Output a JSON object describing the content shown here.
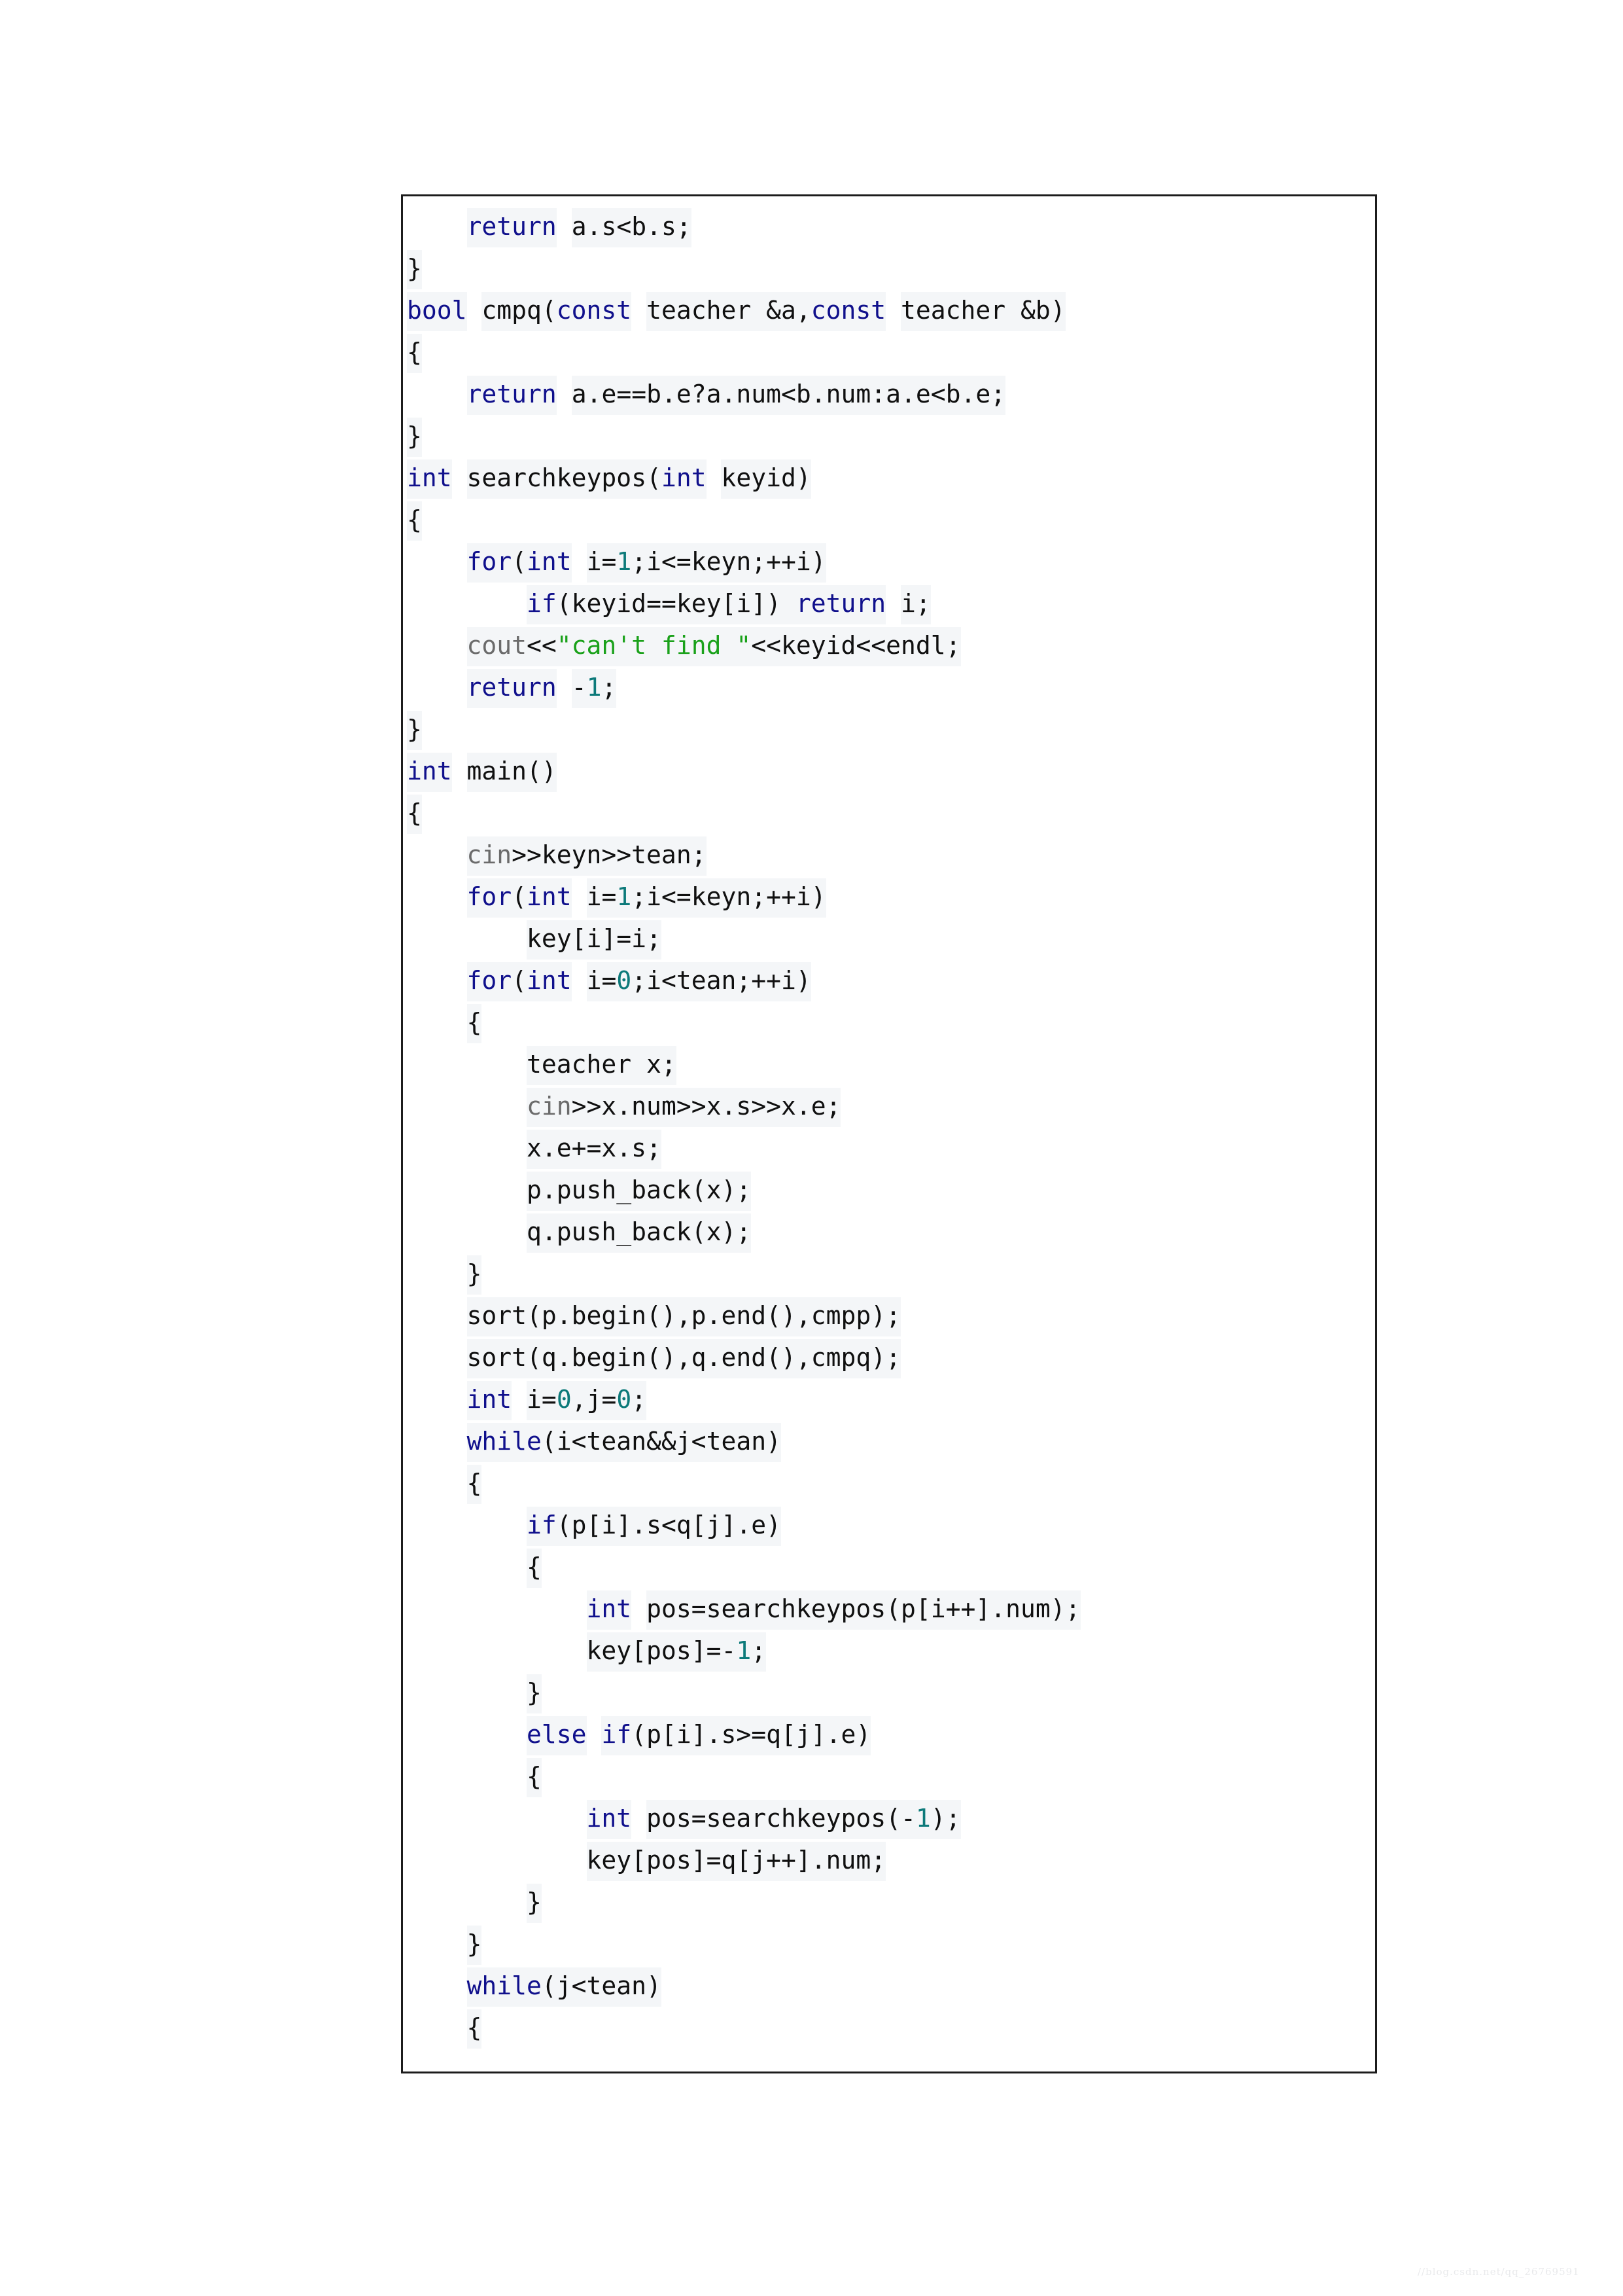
{
  "document": {
    "type": "code-listing",
    "language": "C++",
    "background": "#ffffff",
    "frame_border_color": "#1c1c1c",
    "highlight_band_color": "#f4f6f8"
  },
  "syntax_colors": {
    "keyword": "#10108c",
    "number": "#0d7a7a",
    "string": "#1aa11a",
    "stream_object": "#6b6b6b",
    "plain": "#101010"
  },
  "watermark": {
    "text": "//blog.csdn.net/qq_26769591",
    "color": "#e9eaec"
  },
  "code": {
    "lines": [
      [
        {
          "t": "    ",
          "c": "gap"
        },
        {
          "t": "return",
          "c": "kw"
        },
        {
          "t": " ",
          "c": "gap"
        },
        {
          "t": "a.s<b.s;",
          "c": "pl"
        }
      ],
      [
        {
          "t": "}",
          "c": "pl"
        }
      ],
      [
        {
          "t": "bool",
          "c": "kw"
        },
        {
          "t": " ",
          "c": "gap"
        },
        {
          "t": "cmpq(",
          "c": "pl"
        },
        {
          "t": "const",
          "c": "kw"
        },
        {
          "t": " ",
          "c": "gap"
        },
        {
          "t": "teacher &a,",
          "c": "pl"
        },
        {
          "t": "const",
          "c": "kw"
        },
        {
          "t": " ",
          "c": "gap"
        },
        {
          "t": "teacher &b)",
          "c": "pl"
        }
      ],
      [
        {
          "t": "{",
          "c": "pl"
        }
      ],
      [
        {
          "t": "    ",
          "c": "gap"
        },
        {
          "t": "return",
          "c": "kw"
        },
        {
          "t": " ",
          "c": "gap"
        },
        {
          "t": "a.e==b.e?a.num<b.num:a.e<b.e;",
          "c": "pl"
        }
      ],
      [
        {
          "t": "}",
          "c": "pl"
        }
      ],
      [
        {
          "t": "int",
          "c": "kw"
        },
        {
          "t": " ",
          "c": "gap"
        },
        {
          "t": "searchkeypos(",
          "c": "pl"
        },
        {
          "t": "int",
          "c": "kw"
        },
        {
          "t": " ",
          "c": "gap"
        },
        {
          "t": "keyid)",
          "c": "pl"
        }
      ],
      [
        {
          "t": "{",
          "c": "pl"
        }
      ],
      [
        {
          "t": "    ",
          "c": "gap"
        },
        {
          "t": "for",
          "c": "kw"
        },
        {
          "t": "(",
          "c": "pl"
        },
        {
          "t": "int",
          "c": "kw"
        },
        {
          "t": " ",
          "c": "gap"
        },
        {
          "t": "i=",
          "c": "pl"
        },
        {
          "t": "1",
          "c": "num"
        },
        {
          "t": ";i<=keyn;++i)",
          "c": "pl"
        }
      ],
      [
        {
          "t": "        ",
          "c": "gap"
        },
        {
          "t": "if",
          "c": "kw"
        },
        {
          "t": "(keyid==key[i]) ",
          "c": "pl"
        },
        {
          "t": "return",
          "c": "kw"
        },
        {
          "t": " ",
          "c": "gap"
        },
        {
          "t": "i;",
          "c": "pl"
        }
      ],
      [
        {
          "t": "    ",
          "c": "gap"
        },
        {
          "t": "cout",
          "c": "io"
        },
        {
          "t": "<<",
          "c": "pl"
        },
        {
          "t": "\"can't find \"",
          "c": "str"
        },
        {
          "t": "<<keyid<<endl;",
          "c": "pl"
        }
      ],
      [
        {
          "t": "    ",
          "c": "gap"
        },
        {
          "t": "return",
          "c": "kw"
        },
        {
          "t": " ",
          "c": "gap"
        },
        {
          "t": "-",
          "c": "pl"
        },
        {
          "t": "1",
          "c": "num"
        },
        {
          "t": ";",
          "c": "pl"
        }
      ],
      [
        {
          "t": "}",
          "c": "pl"
        }
      ],
      [
        {
          "t": "int",
          "c": "kw"
        },
        {
          "t": " ",
          "c": "gap"
        },
        {
          "t": "main()",
          "c": "pl"
        }
      ],
      [
        {
          "t": "{",
          "c": "pl"
        }
      ],
      [
        {
          "t": "    ",
          "c": "gap"
        },
        {
          "t": "cin",
          "c": "io"
        },
        {
          "t": ">>keyn>>tean;",
          "c": "pl"
        }
      ],
      [
        {
          "t": "    ",
          "c": "gap"
        },
        {
          "t": "for",
          "c": "kw"
        },
        {
          "t": "(",
          "c": "pl"
        },
        {
          "t": "int",
          "c": "kw"
        },
        {
          "t": " ",
          "c": "gap"
        },
        {
          "t": "i=",
          "c": "pl"
        },
        {
          "t": "1",
          "c": "num"
        },
        {
          "t": ";i<=keyn;++i)",
          "c": "pl"
        }
      ],
      [
        {
          "t": "        ",
          "c": "gap"
        },
        {
          "t": "key[i]=i;",
          "c": "pl"
        }
      ],
      [
        {
          "t": "    ",
          "c": "gap"
        },
        {
          "t": "for",
          "c": "kw"
        },
        {
          "t": "(",
          "c": "pl"
        },
        {
          "t": "int",
          "c": "kw"
        },
        {
          "t": " ",
          "c": "gap"
        },
        {
          "t": "i=",
          "c": "pl"
        },
        {
          "t": "0",
          "c": "num"
        },
        {
          "t": ";i<tean;++i)",
          "c": "pl"
        }
      ],
      [
        {
          "t": "    ",
          "c": "gap"
        },
        {
          "t": "{",
          "c": "pl"
        }
      ],
      [
        {
          "t": "        ",
          "c": "gap"
        },
        {
          "t": "teacher x;",
          "c": "pl"
        }
      ],
      [
        {
          "t": "        ",
          "c": "gap"
        },
        {
          "t": "cin",
          "c": "io"
        },
        {
          "t": ">>x.num>>x.s>>x.e;",
          "c": "pl"
        }
      ],
      [
        {
          "t": "        ",
          "c": "gap"
        },
        {
          "t": "x.e+=x.s;",
          "c": "pl"
        }
      ],
      [
        {
          "t": "        ",
          "c": "gap"
        },
        {
          "t": "p.push_back(x);",
          "c": "pl"
        }
      ],
      [
        {
          "t": "        ",
          "c": "gap"
        },
        {
          "t": "q.push_back(x);",
          "c": "pl"
        }
      ],
      [
        {
          "t": "    ",
          "c": "gap"
        },
        {
          "t": "}",
          "c": "pl"
        }
      ],
      [
        {
          "t": "    ",
          "c": "gap"
        },
        {
          "t": "sort(p.begin(),p.end(),cmpp);",
          "c": "pl"
        }
      ],
      [
        {
          "t": "    ",
          "c": "gap"
        },
        {
          "t": "sort(q.begin(),q.end(),cmpq);",
          "c": "pl"
        }
      ],
      [
        {
          "t": "    ",
          "c": "gap"
        },
        {
          "t": "int",
          "c": "kw"
        },
        {
          "t": " ",
          "c": "gap"
        },
        {
          "t": "i=",
          "c": "pl"
        },
        {
          "t": "0",
          "c": "num"
        },
        {
          "t": ",j=",
          "c": "pl"
        },
        {
          "t": "0",
          "c": "num"
        },
        {
          "t": ";",
          "c": "pl"
        }
      ],
      [
        {
          "t": "    ",
          "c": "gap"
        },
        {
          "t": "while",
          "c": "kw"
        },
        {
          "t": "(i<tean&&j<tean)",
          "c": "pl"
        }
      ],
      [
        {
          "t": "    ",
          "c": "gap"
        },
        {
          "t": "{",
          "c": "pl"
        }
      ],
      [
        {
          "t": "        ",
          "c": "gap"
        },
        {
          "t": "if",
          "c": "kw"
        },
        {
          "t": "(p[i].s<q[j].e)",
          "c": "pl"
        }
      ],
      [
        {
          "t": "        ",
          "c": "gap"
        },
        {
          "t": "{",
          "c": "pl"
        }
      ],
      [
        {
          "t": "            ",
          "c": "gap"
        },
        {
          "t": "int",
          "c": "kw"
        },
        {
          "t": " ",
          "c": "gap"
        },
        {
          "t": "pos=searchkeypos(p[i++].num);",
          "c": "pl"
        }
      ],
      [
        {
          "t": "            ",
          "c": "gap"
        },
        {
          "t": "key[pos]=-",
          "c": "pl"
        },
        {
          "t": "1",
          "c": "num"
        },
        {
          "t": ";",
          "c": "pl"
        }
      ],
      [
        {
          "t": "        ",
          "c": "gap"
        },
        {
          "t": "}",
          "c": "pl"
        }
      ],
      [
        {
          "t": "        ",
          "c": "gap"
        },
        {
          "t": "else",
          "c": "kw"
        },
        {
          "t": " ",
          "c": "gap"
        },
        {
          "t": "if",
          "c": "kw"
        },
        {
          "t": "(p[i].s>=q[j].e)",
          "c": "pl"
        }
      ],
      [
        {
          "t": "        ",
          "c": "gap"
        },
        {
          "t": "{",
          "c": "pl"
        }
      ],
      [
        {
          "t": "            ",
          "c": "gap"
        },
        {
          "t": "int",
          "c": "kw"
        },
        {
          "t": " ",
          "c": "gap"
        },
        {
          "t": "pos=searchkeypos(-",
          "c": "pl"
        },
        {
          "t": "1",
          "c": "num"
        },
        {
          "t": ");",
          "c": "pl"
        }
      ],
      [
        {
          "t": "            ",
          "c": "gap"
        },
        {
          "t": "key[pos]=q[j++].num;",
          "c": "pl"
        }
      ],
      [
        {
          "t": "        ",
          "c": "gap"
        },
        {
          "t": "}",
          "c": "pl"
        }
      ],
      [
        {
          "t": "    ",
          "c": "gap"
        },
        {
          "t": "}",
          "c": "pl"
        }
      ],
      [
        {
          "t": "    ",
          "c": "gap"
        },
        {
          "t": "while",
          "c": "kw"
        },
        {
          "t": "(j<tean)",
          "c": "pl"
        }
      ],
      [
        {
          "t": "    ",
          "c": "gap"
        },
        {
          "t": "{",
          "c": "pl"
        }
      ]
    ]
  }
}
